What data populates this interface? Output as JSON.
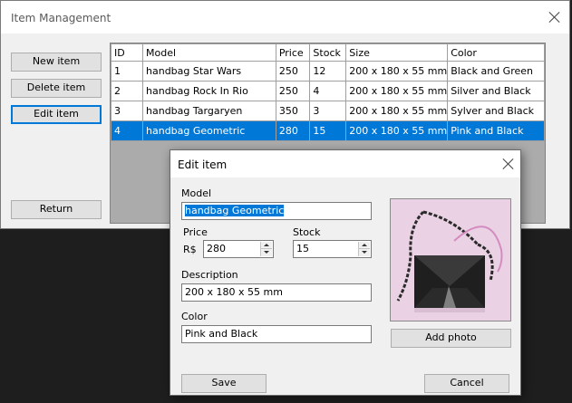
{
  "main": {
    "title": "Item Management",
    "buttons": {
      "new_item": "New item",
      "delete_item": "Delete item",
      "edit_item": "Edit item",
      "return": "Return"
    },
    "grid": {
      "columns": [
        "ID",
        "Model",
        "Price",
        "Stock",
        "Size",
        "Color"
      ],
      "rows": [
        [
          "1",
          "handbag Star Wars",
          "250",
          "12",
          "200 x 180 x 55 mm",
          "Black and Green"
        ],
        [
          "2",
          "handbag Rock In Rio",
          "250",
          "4",
          "200 x 180 x 55 mm",
          "Silver and Black"
        ],
        [
          "3",
          "handbag Targaryen",
          "350",
          "3",
          "200 x 180 x 55 mm",
          "Sylver and Black"
        ],
        [
          "4",
          "handbag Geometric",
          "280",
          "15",
          "200 x 180 x 55 mm",
          "Pink and Black"
        ]
      ],
      "selected_row": 4
    }
  },
  "dialog": {
    "title": "Edit item",
    "model_label": "Model",
    "model_value": "handbag Geometric",
    "price_label": "Price",
    "currency": "R$",
    "price_value": "280",
    "stock_label": "Stock",
    "stock_value": "15",
    "description_label": "Description",
    "description_value": "200 x 180 x 55 mm",
    "color_label": "Color",
    "color_value": "Pink and Black",
    "add_photo": "Add photo",
    "save": "Save",
    "cancel": "Cancel"
  },
  "colors": {
    "selection": "#0078d7",
    "window_bg": "#f0f0f0",
    "desktop": "#1e1e1e"
  },
  "icons": {
    "close": "close-icon",
    "spin_up": "spin-up-icon",
    "spin_down": "spin-down-icon"
  }
}
